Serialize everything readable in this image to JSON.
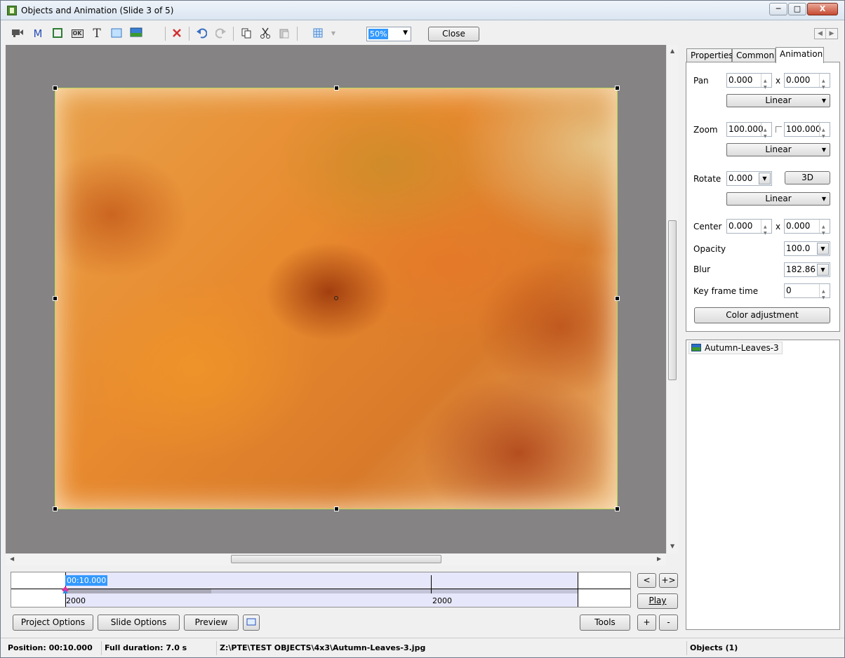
{
  "window": {
    "title": "Objects and Animation  (Slide 3 of 5)",
    "minimize": "─",
    "maximize": "□",
    "close": "X"
  },
  "toolbar": {
    "icons": [
      "camera-icon",
      "m-icon",
      "frame-icon",
      "ok-button-icon",
      "text-icon",
      "rectangle-icon",
      "image-icon",
      "delete-icon",
      "undo-icon",
      "redo-icon",
      "copy-icon",
      "cut-icon",
      "paste-icon",
      "grid-icon"
    ],
    "text_glyph": "T",
    "m_glyph": "M",
    "ok_glyph": "OK",
    "zoom_value": "50%",
    "close_label": "Close",
    "delete_color": "#d03030"
  },
  "timeline": {
    "current_time": "00:10.000",
    "start_label": "2000",
    "mid_label": "2000",
    "prev_button": "<",
    "next_button": "+>",
    "play_button": "Play"
  },
  "bottom_buttons": {
    "project_options": "Project Options",
    "slide_options": "Slide Options",
    "preview": "Preview",
    "tools": "Tools",
    "plus": "+",
    "minus": "-"
  },
  "tabs": {
    "properties": "Properties",
    "common": "Common",
    "animation": "Animation"
  },
  "animation": {
    "pan_label": "Pan",
    "pan_x": "0.000",
    "pan_y": "0.000",
    "pan_easing": "Linear",
    "zoom_label": "Zoom",
    "zoom_x": "100.000",
    "zoom_y": "100.000",
    "zoom_easing": "Linear",
    "rotate_label": "Rotate",
    "rotate_value": "0.000",
    "three_d_button": "3D",
    "rotate_easing": "Linear",
    "center_label": "Center",
    "center_x": "0.000",
    "center_y": "0.000",
    "x_sep": "x",
    "opacity_label": "Opacity",
    "opacity_value": "100.0",
    "blur_label": "Blur",
    "blur_value": "182.86",
    "keyframe_label": "Key frame time",
    "keyframe_value": "0",
    "color_adjustment": "Color adjustment"
  },
  "objects": {
    "items": [
      "Autumn-Leaves-3"
    ]
  },
  "status": {
    "position": "Position:  00:10.000",
    "duration": "Full duration:  7.0 s",
    "path": "Z:\\PTE\\TEST OBJECTS\\4x3\\Autumn-Leaves-3.jpg",
    "objects_count": "Objects (1)"
  }
}
